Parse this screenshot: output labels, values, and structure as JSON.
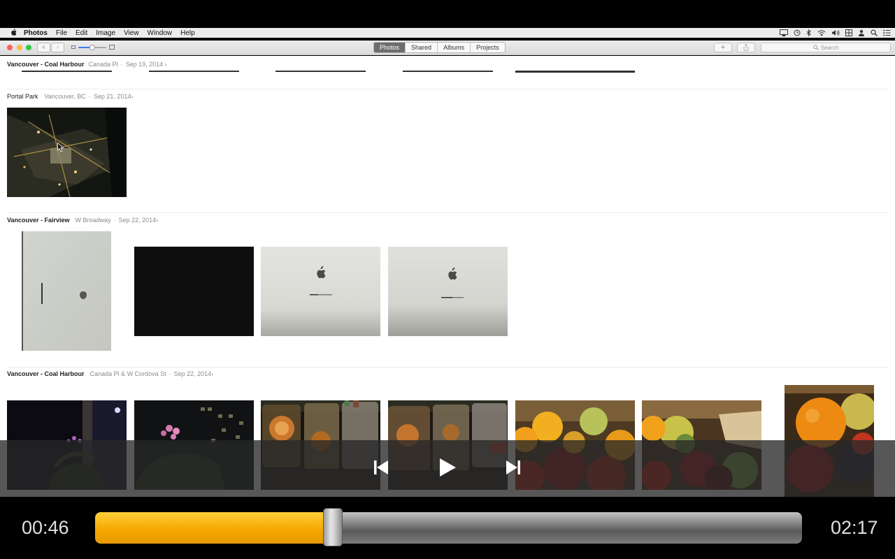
{
  "menubar": {
    "apple_symbol": "",
    "app_name": "Photos",
    "items": [
      "File",
      "Edit",
      "Image",
      "View",
      "Window",
      "Help"
    ]
  },
  "toolbar": {
    "back_symbol": "‹",
    "forward_symbol": "›",
    "zoom_level": 0.5,
    "tabs": [
      {
        "label": "Photos",
        "active": true
      },
      {
        "label": "Shared",
        "active": false
      },
      {
        "label": "Albums",
        "active": false
      },
      {
        "label": "Projects",
        "active": false
      }
    ],
    "add_symbol": "+",
    "search_placeholder": "Search"
  },
  "moments": [
    {
      "title": "Vancouver - Coal Harbour",
      "location": "Canada Pl",
      "date": "Sep 19, 2014"
    },
    {
      "title": "Portal Park",
      "location": "Vancouver, BC",
      "date": "Sep 21, 2014"
    },
    {
      "title": "Vancouver - Fairview",
      "location": "W Broadway",
      "date": "Sep 22, 2014"
    },
    {
      "title": "Vancouver - Coal Harbour",
      "location": "Canada Pl & W Cordova St",
      "date": "Sep 22, 2014"
    }
  ],
  "video": {
    "elapsed": "00:46",
    "duration": "02:17",
    "progress": 0.336
  },
  "colors": {
    "accent": "#f5a800",
    "active_tab": "#6d6d6d",
    "close": "#fc605c",
    "minimize": "#fdbc40",
    "zoom": "#34c84a"
  }
}
